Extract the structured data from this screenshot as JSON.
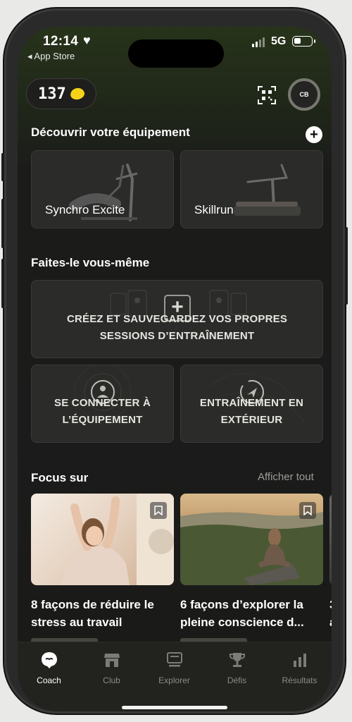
{
  "status_bar": {
    "time": "12:14",
    "back_app": "◂ App Store",
    "network": "5G",
    "battery_level": 0.4
  },
  "header": {
    "points": "137",
    "avatar_initials": "CB",
    "coin_color": "#f5d218"
  },
  "equipment_section": {
    "title": "Découvrir votre équipement",
    "add_label": "+",
    "items": [
      {
        "name": "Synchro Excite"
      },
      {
        "name": "Skillrun"
      }
    ]
  },
  "diy_section": {
    "title": "Faites-le vous-même",
    "create_line1": "CRÉEZ ET SAUVEGARDEZ VOS PROPRES",
    "create_line2": "SESSIONS D’ENTRAÎNEMENT",
    "connect_line1": "SE CONNECTER À",
    "connect_line2": "L’ÉQUIPEMENT",
    "outdoor_line1": "ENTRAÎNEMENT EN",
    "outdoor_line2": "EXTÉRIEUR"
  },
  "focus_section": {
    "title": "Focus sur",
    "see_all": "Afficher tout",
    "articles": [
      {
        "line1": "8 façons de réduire le",
        "line2": "stress au travail"
      },
      {
        "line1": "6 façons d’explorer la",
        "line2": "pleine conscience d..."
      },
      {
        "line1": "3",
        "line2": "a"
      }
    ]
  },
  "tabbar": {
    "tabs": [
      {
        "label": "Coach",
        "icon": "coach-icon",
        "active": true
      },
      {
        "label": "Club",
        "icon": "club-icon",
        "active": false
      },
      {
        "label": "Explorer",
        "icon": "explorer-icon",
        "active": false
      },
      {
        "label": "Défis",
        "icon": "trophy-icon",
        "active": false
      },
      {
        "label": "Résultats",
        "icon": "results-icon",
        "active": false
      }
    ]
  }
}
